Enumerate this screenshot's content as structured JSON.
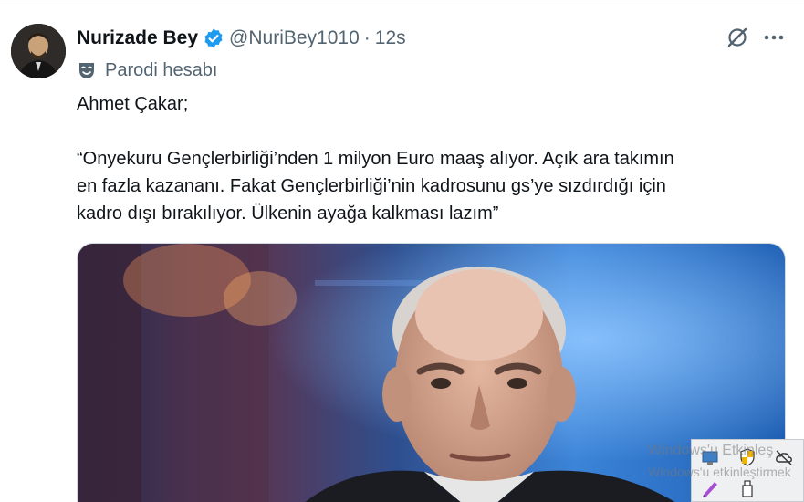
{
  "tweet": {
    "display_name": "Nurizade Bey",
    "verified": true,
    "handle": "@NuriBey1010",
    "separator": "·",
    "timestamp": "12s",
    "account_label": "Parodi hesabı",
    "text_lines": [
      "Ahmet Çakar;",
      "“Onyekuru Gençlerbirliği’nden 1 milyon Euro maaş alıyor. Açık ara takımın",
      "en fazla kazananı. Fakat Gençlerbirliği’nin kadrosunu gs’ye sızdırdığı için",
      "kadro dışı bırakılıyor. Ülkenin ayağa kalkması lazım”"
    ]
  },
  "icons": {
    "verified": "verified-badge-icon",
    "grok": "grok-icon",
    "more": "more-options-icon",
    "parody": "parody-mask-icon"
  },
  "windows_overlay": {
    "line1": "Windows'u Etkinleş",
    "line2": "Windows'u etkinleştirmek"
  },
  "colors": {
    "primary_text": "#0f1419",
    "secondary_text": "#536471",
    "verified_blue": "#1d9bf0"
  }
}
